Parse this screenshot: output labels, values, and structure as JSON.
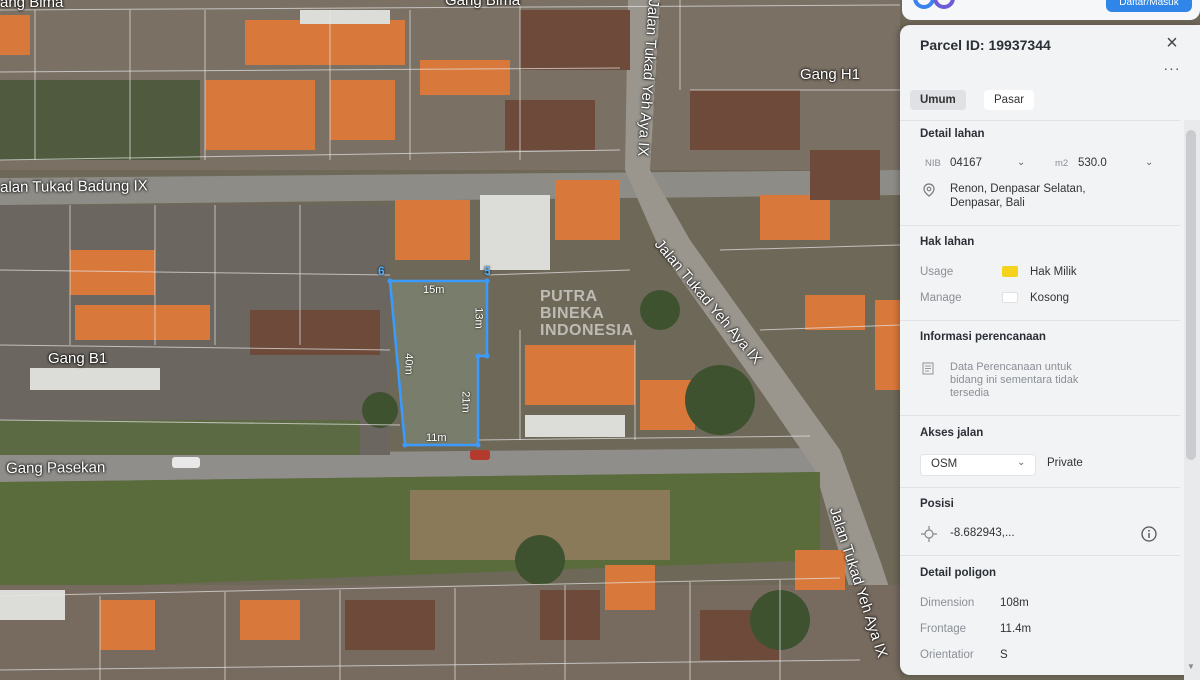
{
  "map": {
    "streets": {
      "gang_bima": "Gang Bima",
      "gang_bima_left": "ang Bima",
      "gang_h1": "Gang H1",
      "jalan_tukad_badung": "alan Tukad Badung IX",
      "jalan_tukad_yeh_aya_top": "Jalan Tukad Yeh Aya IX",
      "jalan_tukad_yeh_aya_mid": "Jalan Tukad Yeh Aya IX",
      "jalan_tukad_yeh_aya_bottom": "Jalan Tukad Yeh Aya IX",
      "gang_b1": "Gang B1",
      "gang_pasekan": "Gang Pasekan"
    },
    "dimensions": {
      "top": "15m",
      "right_upper": "13m",
      "left": "40m",
      "right_lower": "21m",
      "bottom": "11m"
    },
    "vertices": {
      "v6": "6",
      "v5": "5"
    },
    "watermark": [
      "PUTRA",
      "BINEKA",
      "INDONESIA"
    ],
    "parcel_color": "#3a9bff"
  },
  "topbar": {
    "login_label": "Daftar/Masuk"
  },
  "panel": {
    "title": "Parcel ID: 19937344",
    "close_icon": "close-icon",
    "more_icon": "more-icon",
    "tabs": [
      {
        "label": "Umum",
        "active": true
      },
      {
        "label": "Pasar",
        "active": false
      }
    ],
    "detail_lahan": {
      "heading": "Detail lahan",
      "nib_label": "NIB",
      "nib_value": "04167",
      "area_label": "m2",
      "area_value": "530.0",
      "address_line1": "Renon, Denpasar Selatan,",
      "address_line2": "Denpasar, Bali"
    },
    "hak_lahan": {
      "heading": "Hak lahan",
      "usage_label": "Usage",
      "usage_value": "Hak Milik",
      "usage_color": "#f5d31c",
      "manage_label": "Manage",
      "manage_value": "Kosong",
      "manage_color": "#ffffff"
    },
    "informasi": {
      "heading": "Informasi perencanaan",
      "line1": "Data Perencanaan untuk",
      "line2": "bidang ini sementara tidak",
      "line3": "tersedia"
    },
    "akses": {
      "heading": "Akses jalan",
      "select_value": "OSM",
      "access_value": "Private"
    },
    "posisi": {
      "heading": "Posisi",
      "value": "-8.682943,..."
    },
    "poligon": {
      "heading": "Detail poligon",
      "dimension_label": "Dimension",
      "dimension_value": "108m",
      "frontage_label": "Frontage",
      "frontage_value": "11.4m",
      "orientation_label": "Orientatior",
      "orientation_value": "S"
    }
  }
}
